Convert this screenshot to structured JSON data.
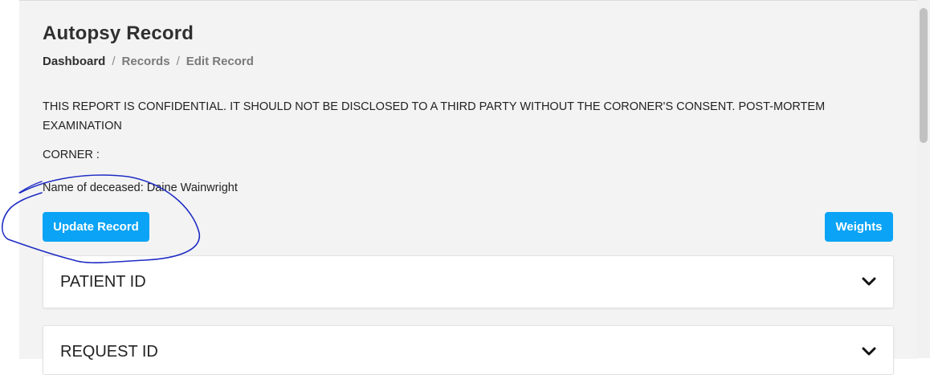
{
  "header": {
    "title": "Autopsy Record",
    "breadcrumb": [
      "Dashboard",
      "Records",
      "Edit Record"
    ],
    "separator": "/"
  },
  "record": {
    "notice": "THIS REPORT IS CONFIDENTIAL. IT SHOULD NOT BE DISCLOSED TO A THIRD PARTY WITHOUT THE CORONER'S CONSENT. POST-MORTEM EXAMINATION",
    "coroner_label": "CORNER :",
    "deceased_line": "Name of deceased: Daine Wainwright"
  },
  "actions": {
    "update_label": "Update Record",
    "weights_label": "Weights"
  },
  "sections": [
    {
      "title": "PATIENT ID",
      "icon": "chevron-down-icon"
    },
    {
      "title": "REQUEST ID",
      "icon": "chevron-down-icon"
    }
  ],
  "colors": {
    "accent": "#0aa3f5",
    "page_background": "#f3f3f3",
    "annotation_ink": "#1f2cc4"
  }
}
